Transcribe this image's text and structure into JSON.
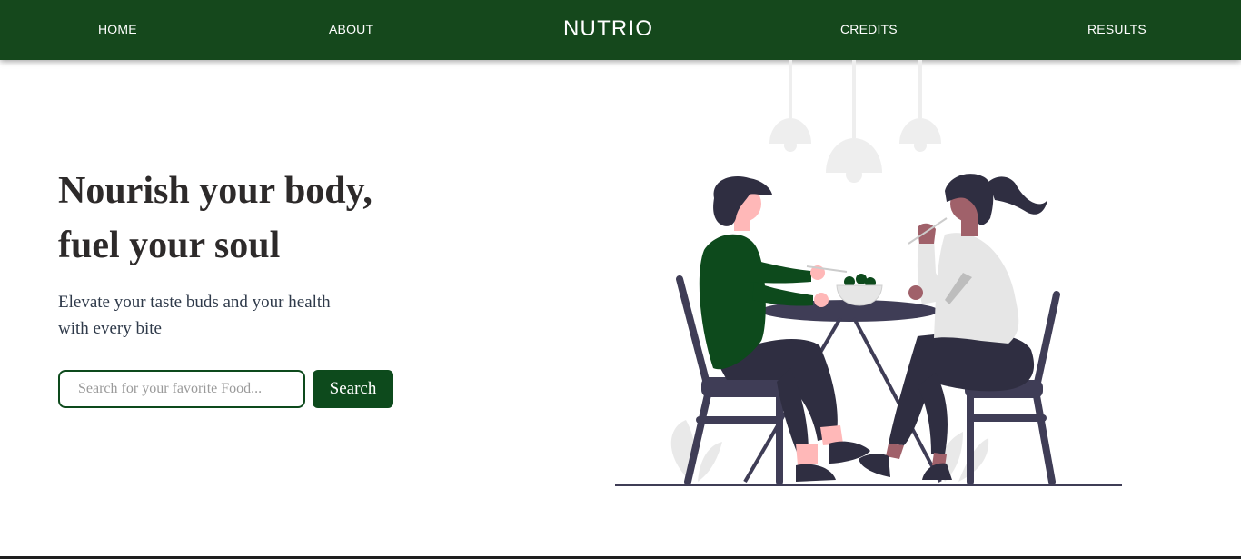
{
  "nav": {
    "home": "HOME",
    "about": "ABOUT",
    "brand": "NUTRIO",
    "credits": "CREDITS",
    "results": "RESULTS"
  },
  "hero": {
    "title_line1": "Nourish your body,",
    "title_line2": "fuel your soul",
    "subtitle": "Elevate your taste buds and your health with every bite"
  },
  "search": {
    "placeholder": "Search for your favorite Food...",
    "value": "",
    "button_label": "Search"
  },
  "colors": {
    "nav_background": "#15481c",
    "accent_green": "#0d4a1c",
    "heading_text": "#2d2a2a"
  },
  "illustration": {
    "subject": "couple-eating-at-table",
    "icons": [
      "pendant-lamp-icon",
      "salad-bowl-icon"
    ]
  }
}
